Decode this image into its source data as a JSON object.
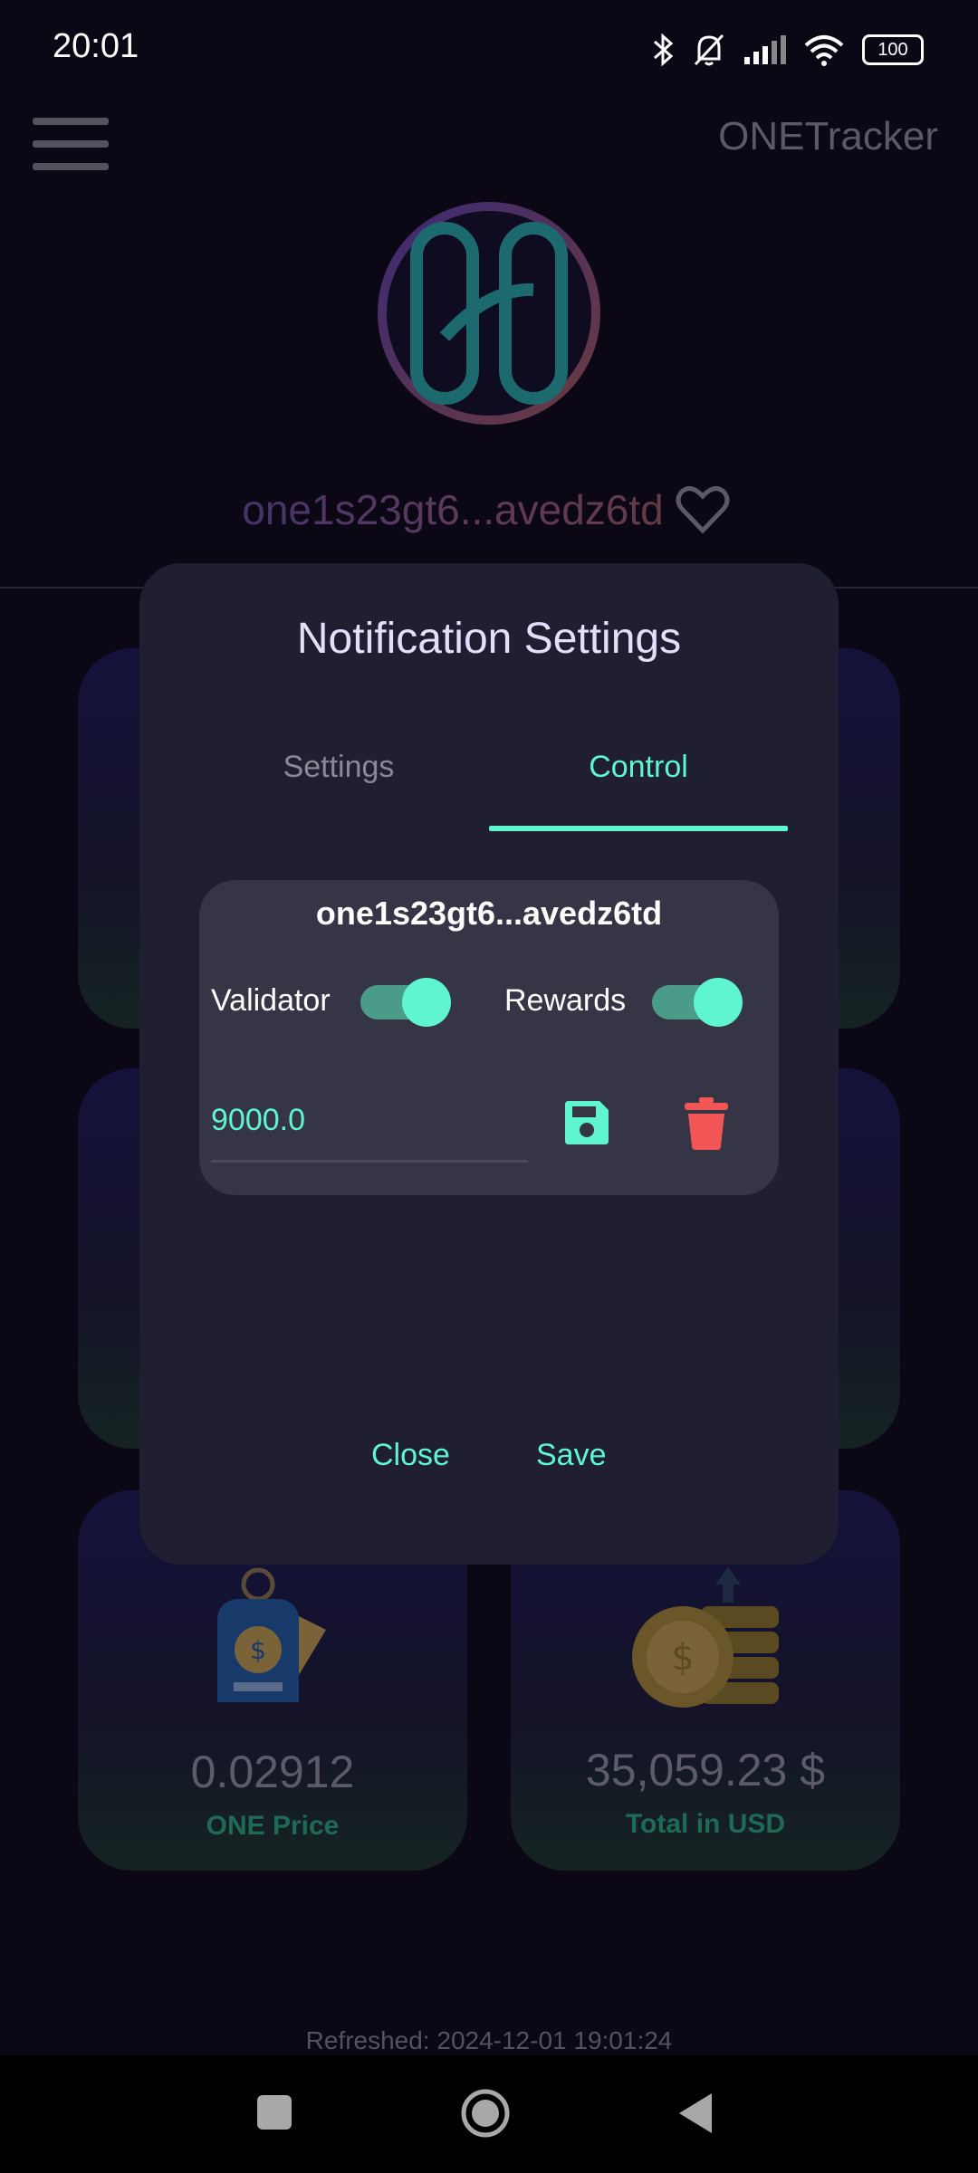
{
  "status_bar": {
    "time": "20:01",
    "battery": "100"
  },
  "app_bar": {
    "title": "ONETracker"
  },
  "wallet": {
    "address": "one1s23gt6...avedz6td"
  },
  "dialog": {
    "title": "Notification Settings",
    "tabs": [
      {
        "label": "Settings",
        "active": false
      },
      {
        "label": "Control",
        "active": true
      }
    ],
    "entry": {
      "address": "one1s23gt6...avedz6td",
      "validator_label": "Validator",
      "validator_on": true,
      "rewards_label": "Rewards",
      "rewards_on": true,
      "amount": "9000.0"
    },
    "close_label": "Close",
    "save_label": "Save"
  },
  "cards": {
    "price": {
      "value": "0.02912",
      "label": "ONE Price"
    },
    "total": {
      "value": "35,059.23 $",
      "label": "Total in USD"
    }
  },
  "footer": {
    "refreshed": "Refreshed: 2024-12-01 19:01:24"
  },
  "colors": {
    "accent": "#5ff5cf",
    "danger": "#f25555",
    "dialog_bg": "#1f1f31",
    "panel_bg": "#353545"
  }
}
